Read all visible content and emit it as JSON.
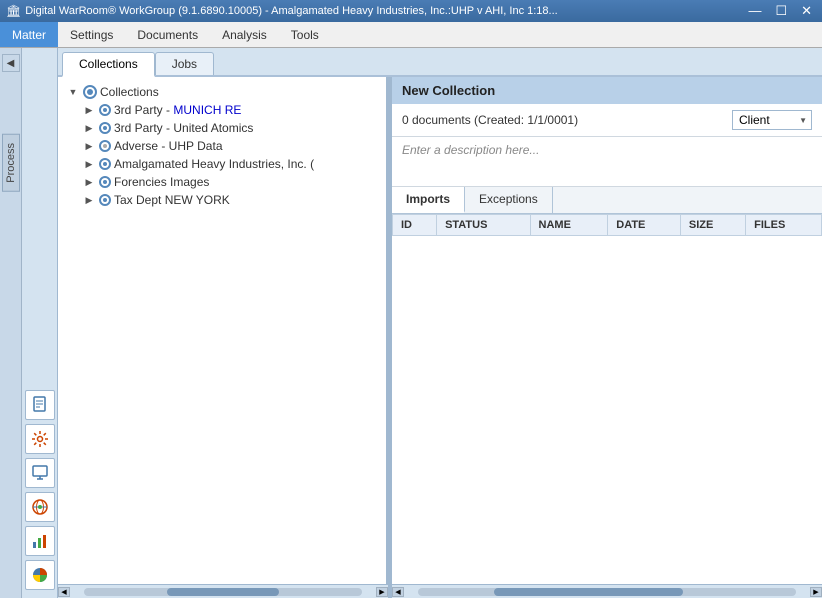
{
  "titlebar": {
    "title": "Digital WarRoom® WorkGroup (9.1.6890.10005) - Amalgamated Heavy Industries, Inc.:UHP v AHI, Inc 1:18...",
    "icon": "⚙",
    "minimize": "—",
    "restore": "☐",
    "close": "✕"
  },
  "menubar": {
    "items": [
      "Matter",
      "Settings",
      "Documents",
      "Analysis",
      "Tools"
    ],
    "active": "Matter"
  },
  "tabs": {
    "items": [
      "Collections",
      "Jobs"
    ],
    "active": "Collections"
  },
  "tree": {
    "root_label": "Collections",
    "items": [
      {
        "label": "3rd Party - MUNICH RE",
        "highlight": true
      },
      {
        "label": "3rd Party - United Atomics",
        "highlight": false
      },
      {
        "label": "Adverse - UHP Data",
        "highlight": false
      },
      {
        "label": "Amalgamated Heavy Industries, Inc. (",
        "highlight": false
      },
      {
        "label": "Forencies Images",
        "highlight": false
      },
      {
        "label": "Tax Dept NEW YORK",
        "highlight": false
      }
    ]
  },
  "right_panel": {
    "header": "New Collection",
    "meta": "0 documents (Created: 1/1/0001)",
    "client_label": "Client",
    "description_placeholder": "Enter a description here...",
    "inner_tabs": [
      "Imports",
      "Exceptions"
    ],
    "active_inner_tab": "Imports",
    "table_headers": [
      "ID",
      "STATUS",
      "NAME",
      "DATE",
      "SIZE",
      "FILES"
    ]
  },
  "process_tab": {
    "label": "Process"
  },
  "sidebar_icons": [
    {
      "name": "document-icon",
      "symbol": "📄"
    },
    {
      "name": "gear-icon",
      "symbol": "⚙"
    },
    {
      "name": "monitor-icon",
      "symbol": "🖥"
    },
    {
      "name": "globe-icon",
      "symbol": "🌐"
    },
    {
      "name": "chart-bar-icon",
      "symbol": "📊"
    },
    {
      "name": "chart-pie-icon",
      "symbol": "🍩"
    }
  ]
}
